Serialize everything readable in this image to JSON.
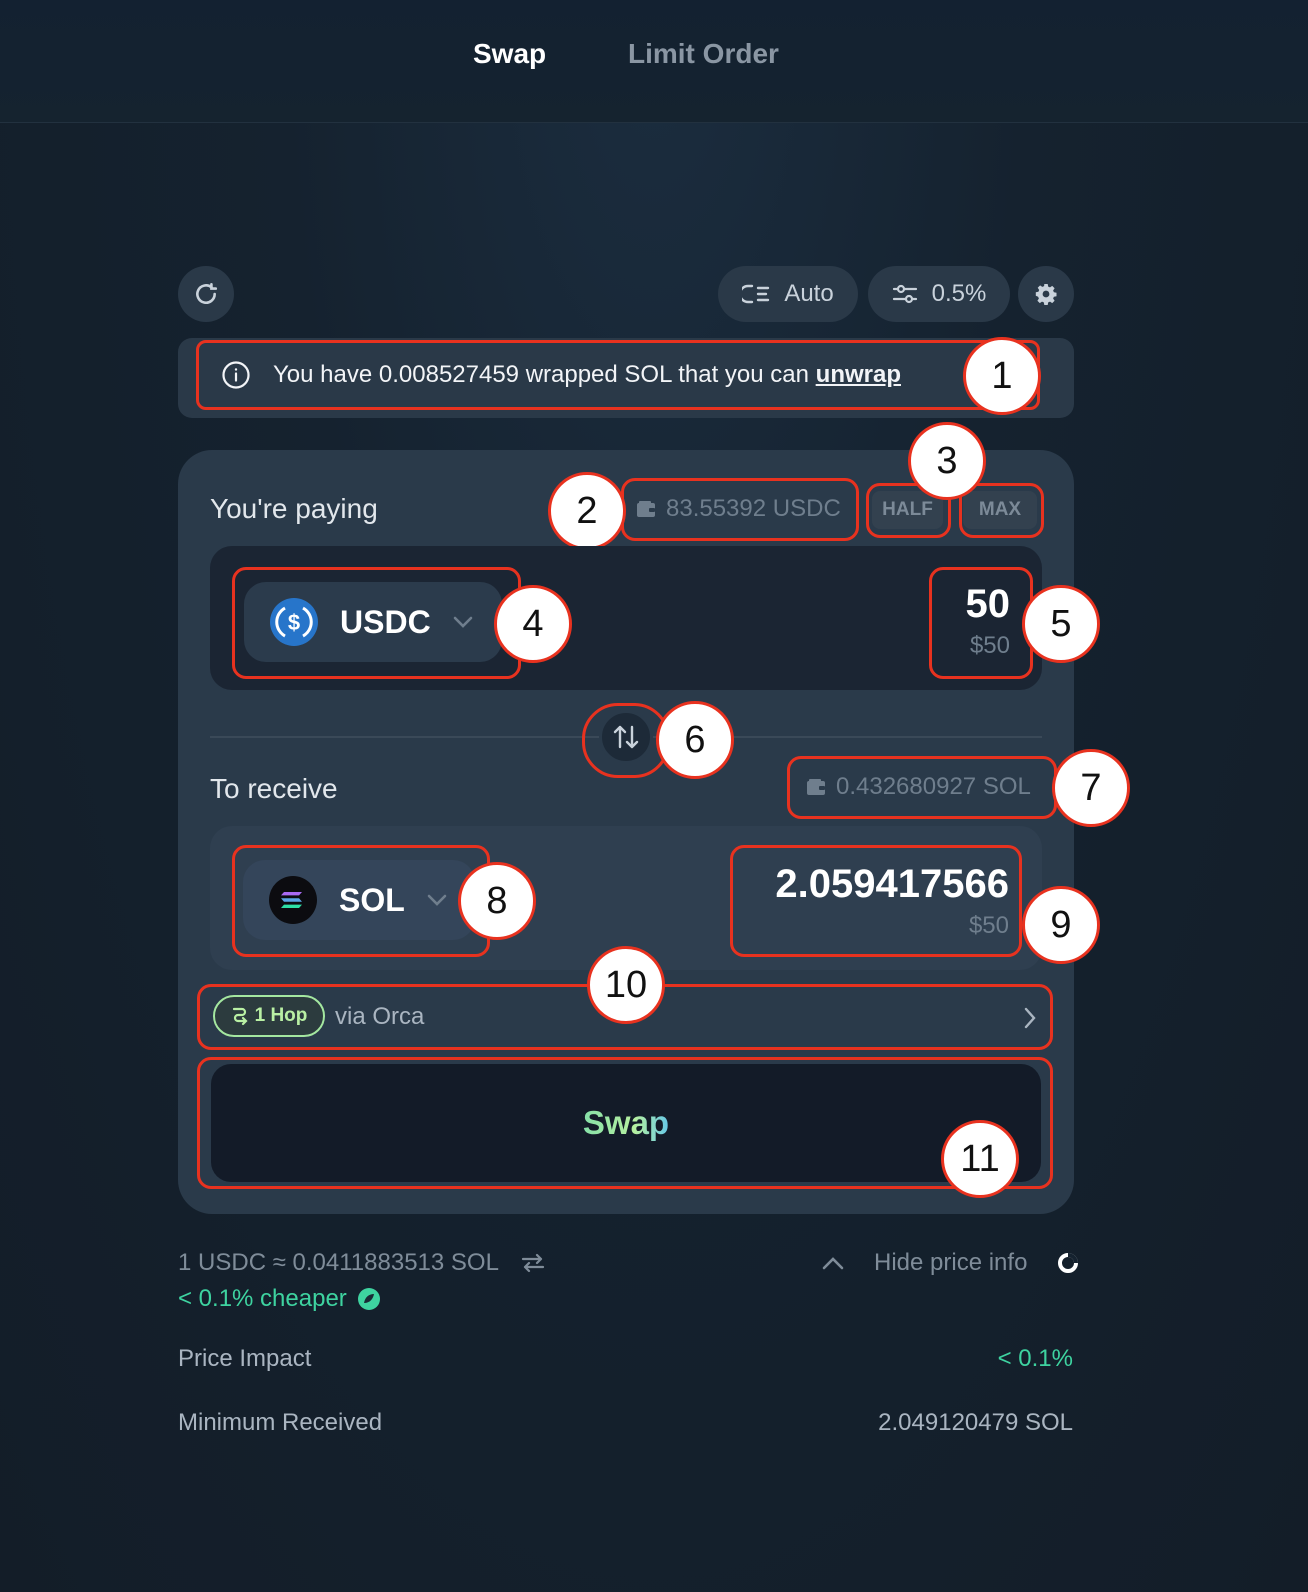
{
  "tabs": {
    "swap": "Swap",
    "limit_order": "Limit Order"
  },
  "toolbar": {
    "route_mode": "Auto",
    "slippage": "0.5%"
  },
  "notice": {
    "text": "You have 0.008527459 wrapped SOL that you can",
    "link": "unwrap"
  },
  "paying": {
    "label": "You're paying",
    "balance": "83.55392 USDC",
    "half": "HALF",
    "max": "MAX",
    "token": "USDC",
    "amount": "50",
    "amount_usd": "$50"
  },
  "receiving": {
    "label": "To receive",
    "balance": "0.432680927 SOL",
    "token": "SOL",
    "amount": "2.059417566",
    "amount_usd": "$50"
  },
  "route": {
    "hops": "1 Hop",
    "via": "via Orca"
  },
  "swap_button": "Swap",
  "price_info": {
    "rate": "1 USDC ≈ 0.0411883513 SOL",
    "cheaper": "< 0.1% cheaper",
    "toggle": "Hide price info",
    "price_impact_label": "Price Impact",
    "price_impact_value": "< 0.1%",
    "min_received_label": "Minimum Received",
    "min_received_value": "2.049120479 SOL"
  },
  "annotations": [
    "1",
    "2",
    "3",
    "4",
    "5",
    "6",
    "7",
    "8",
    "9",
    "10",
    "11"
  ],
  "colors": {
    "accent_red": "#e8321f",
    "green": "#3ed3a0",
    "usdc_blue": "#2775ca"
  }
}
